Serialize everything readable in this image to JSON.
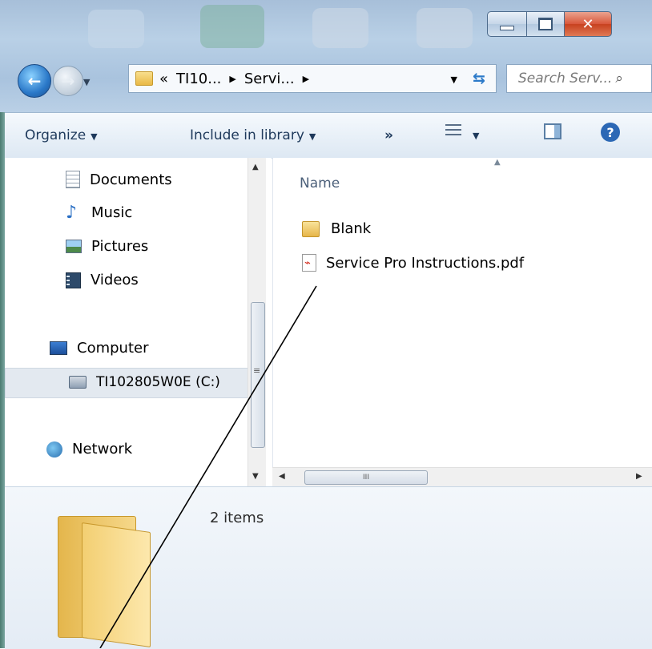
{
  "address_bar": {
    "crumbs": [
      "«",
      "TI10...",
      "Servi..."
    ],
    "search_placeholder": "Search Serv..."
  },
  "toolbar": {
    "organize_label": "Organize",
    "include_label": "Include in library",
    "more_label": "»"
  },
  "nav_pane": {
    "items": [
      {
        "label": "Documents",
        "icon": "documents-icon"
      },
      {
        "label": "Music",
        "icon": "music-icon"
      },
      {
        "label": "Pictures",
        "icon": "pictures-icon"
      },
      {
        "label": "Videos",
        "icon": "videos-icon"
      },
      {
        "label": "Computer",
        "icon": "computer-icon"
      },
      {
        "label": "TI102805W0E (C:)",
        "icon": "drive-icon",
        "selected": true
      },
      {
        "label": "Network",
        "icon": "network-icon"
      }
    ]
  },
  "file_list": {
    "column_name": "Name",
    "files": [
      {
        "name": "Blank",
        "type": "folder"
      },
      {
        "name": "Service Pro Instructions.pdf",
        "type": "pdf"
      }
    ]
  },
  "scrollbar": {
    "hthumb_glyph": "III",
    "vthumb_glyph": "≡"
  },
  "details": {
    "count_text": "2 items"
  },
  "colors": {
    "accent": "#2a78c8",
    "close": "#c7411f",
    "selection": "#e3e9f0"
  }
}
